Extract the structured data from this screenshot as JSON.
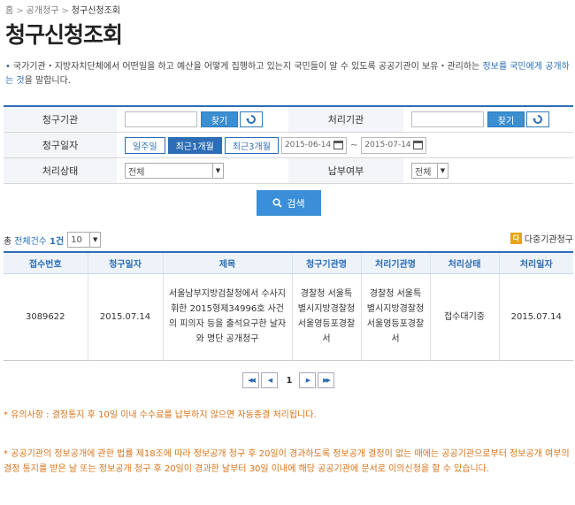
{
  "breadcrumb": {
    "home": "홈",
    "level1": "공개청구",
    "current": "청구신청조회",
    "separator": ">"
  },
  "page_title": "청구신청조회",
  "intro": {
    "bullet": "•",
    "text": "국가기관・지방자치단체에서 어떤일을 하고 예산을 어떻게 집행하고 있는지 국민들이 알 수 있도록 공공기관이 보유・관리하는 ",
    "link": "정보를 국민에게 공개하는 것",
    "text_end": "을 말합니다."
  },
  "form": {
    "request_org_label": "청구기관",
    "request_org_value": "",
    "find_label": "찾기",
    "process_org_label": "처리기관",
    "process_org_value": "",
    "request_date_label": "청구일자",
    "period_buttons": [
      "일주일",
      "최근1개월",
      "최근3개월"
    ],
    "period_active": "최근1개월",
    "date_from": "2015-06-14",
    "date_to": "2015-07-14",
    "tilde": "~",
    "status_label": "처리상태",
    "status_value": "전체",
    "payment_label": "납부여부",
    "payment_value": "전체"
  },
  "search_button": "검색",
  "results": {
    "total_prefix": "총",
    "total_label": "전체건수",
    "total_count": "1건",
    "page_size": "10",
    "multi_org_label": "다중기관청구",
    "multi_org_icon_text": "다"
  },
  "table": {
    "headers": [
      "접수번호",
      "청구일자",
      "제목",
      "청구기관명",
      "처리기관명",
      "처리상태",
      "처리일자"
    ],
    "rows": [
      {
        "receipt_no": "3089622",
        "request_date": "2015.07.14",
        "title": "서울남부지방검찰청에서 수사지휘한 2015형제34996호 사건의 피의자 등을 출석요구한 날자 와 명단 공개청구",
        "request_org": "경찰청 서울특별시지방경찰청 서울영등포경찰서",
        "process_org": "경찰청 서울특별시지방경찰청 서울영등포경찰서",
        "status": "접수대기중",
        "process_date": "2015.07.14"
      }
    ]
  },
  "pagination": {
    "current": "1"
  },
  "notices": {
    "notice1": "* 유의사항 : 결정통지 후 10일 이내 수수료를 납부하지 않으면 자동종결 처리됩니다.",
    "notice2": "* 공공기관의 정보공개에 관한 법률 제18조에 따라 정보공개 청구 후 20일이 경과하도록 정보공개 결정이 없는 때에는 공공기관으로부터 정보공개 여부의 결정 통지를 받은 날 또는 정보공개 청구 후 20일이 경과한 날부터 30일 이내에 해당 공공기관에 문서로 이의신청을 할 수 있습니다."
  },
  "colors": {
    "primary": "#2d6db5",
    "notice": "#d9731a",
    "button": "#3a8fd8"
  }
}
